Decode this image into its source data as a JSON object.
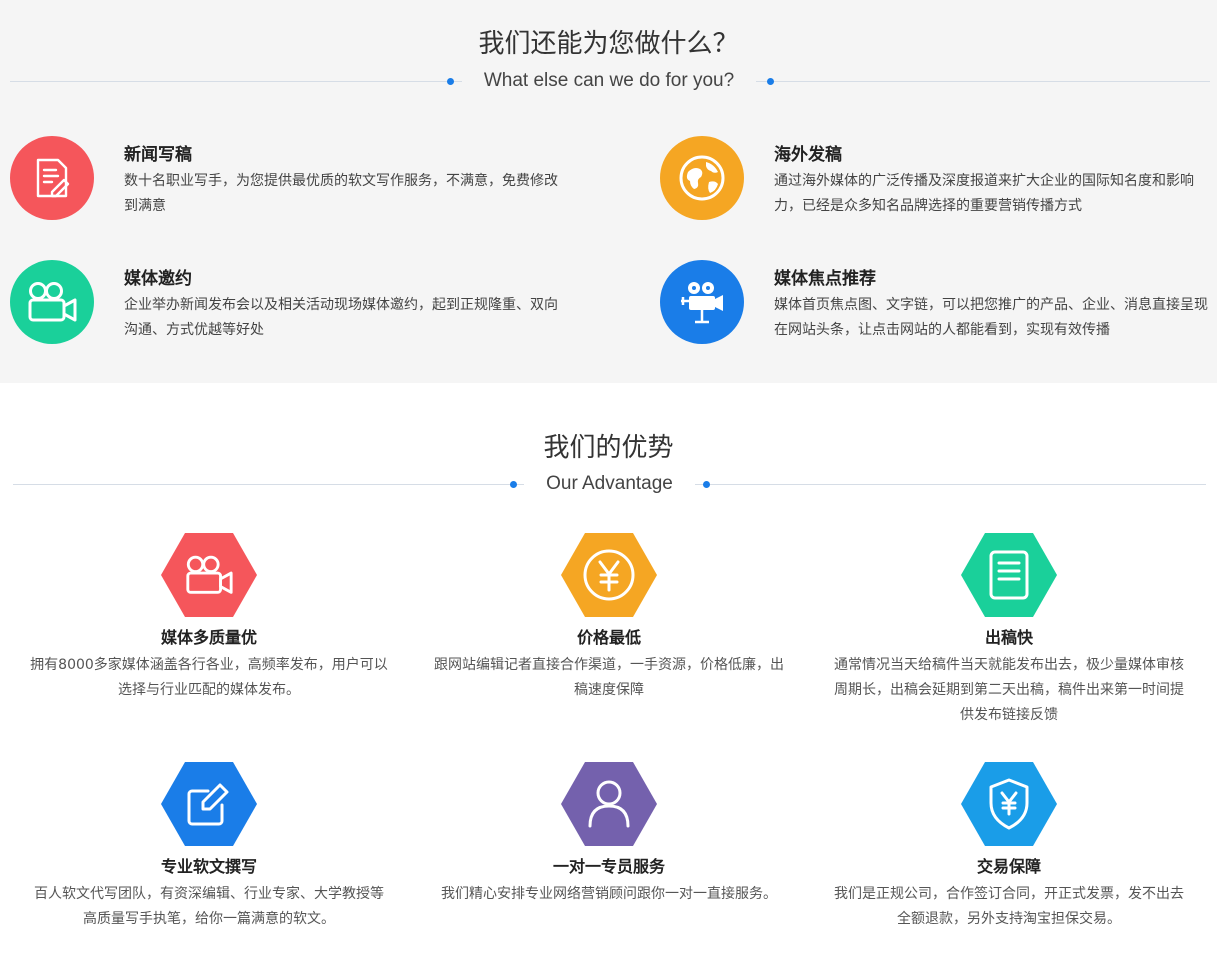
{
  "services_section": {
    "title": "我们还能为您做什么？",
    "subtitle": "What else can we do for you?",
    "items": [
      {
        "title": "新闻写稿",
        "desc": "数十名职业写手，为您提供最优质的软文写作服务，不满意，免费修改到满意",
        "icon": "document-pen-icon",
        "color": "#f5565b"
      },
      {
        "title": "海外发稿",
        "desc": "通过海外媒体的广泛传播及深度报道来扩大企业的国际知名度和影响力，已经是众多知名品牌选择的重要营销传播方式",
        "icon": "globe-icon",
        "color": "#f5a623"
      },
      {
        "title": "媒体邀约",
        "desc": "企业举办新闻发布会以及相关活动现场媒体邀约，起到正规隆重、双向沟通、方式优越等好处",
        "icon": "video-camera-icon",
        "color": "#1ad09a"
      },
      {
        "title": "媒体焦点推荐",
        "desc": "媒体首页焦点图、文字链，可以把您推广的产品、企业、消息直接呈现在网站头条，让点击网站的人都能看到，实现有效传播",
        "icon": "projector-icon",
        "color": "#1a7de8"
      }
    ]
  },
  "advantage_section": {
    "title": "我们的优势",
    "subtitle": "Our Advantage",
    "items": [
      {
        "title": "媒体多质量优",
        "desc": "拥有8000多家媒体涵盖各行各业，高频率发布，用户可以选择与行业匹配的媒体发布。",
        "icon": "video-camera-icon",
        "color": "#f5565b"
      },
      {
        "title": "价格最低",
        "desc": "跟网站编辑记者直接合作渠道，一手资源，价格低廉，出稿速度保障",
        "icon": "yen-coin-icon",
        "color": "#f5a623"
      },
      {
        "title": "出稿快",
        "desc": "通常情况当天给稿件当天就能发布出去，极少量媒体审核周期长，出稿会延期到第二天出稿，稿件出来第一时间提供发布链接反馈",
        "icon": "document-icon",
        "color": "#1ad09a"
      },
      {
        "title": "专业软文撰写",
        "desc": "百人软文代写团队，有资深编辑、行业专家、大学教授等高质量写手执笔，给你一篇满意的软文。",
        "icon": "edit-icon",
        "color": "#1a7de8"
      },
      {
        "title": "一对一专员服务",
        "desc": "我们精心安排专业网络营销顾问跟你一对一直接服务。",
        "icon": "user-icon",
        "color": "#7461ad"
      },
      {
        "title": "交易保障",
        "desc": "我们是正规公司，合作签订合同，开正式发票，发不出去全额退款，另外支持淘宝担保交易。",
        "icon": "shield-yen-icon",
        "color": "#1a9de8"
      }
    ]
  }
}
